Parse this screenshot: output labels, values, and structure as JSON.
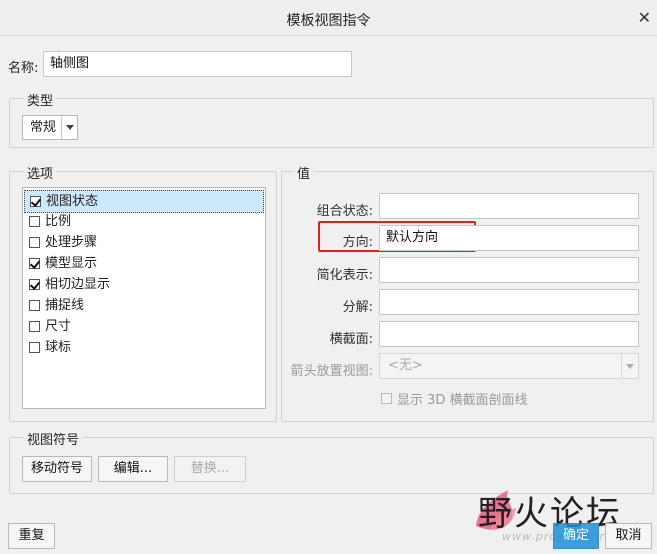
{
  "dialog": {
    "title": "模板视图指令",
    "close_icon": "close-icon"
  },
  "name_field": {
    "label": "名称:",
    "value": "轴侧图"
  },
  "type_group": {
    "label": "类型",
    "selected": "常规"
  },
  "options_group": {
    "label": "选项",
    "items": [
      {
        "label": "视图状态",
        "checked": true,
        "selected": true
      },
      {
        "label": "比例",
        "checked": false,
        "selected": false
      },
      {
        "label": "处理步骤",
        "checked": false,
        "selected": false
      },
      {
        "label": "模型显示",
        "checked": true,
        "selected": false
      },
      {
        "label": "相切边显示",
        "checked": true,
        "selected": false
      },
      {
        "label": "捕捉线",
        "checked": false,
        "selected": false
      },
      {
        "label": "尺寸",
        "checked": false,
        "selected": false
      },
      {
        "label": "球标",
        "checked": false,
        "selected": false
      }
    ]
  },
  "values_group": {
    "label": "值",
    "fields": {
      "combo_state": {
        "label": "组合状态:",
        "value": ""
      },
      "orientation": {
        "label": "方向:",
        "value": "默认方向"
      },
      "simplified_rep": {
        "label": "简化表示:",
        "value": ""
      },
      "explode": {
        "label": "分解:",
        "value": ""
      },
      "cross_section": {
        "label": "横截面:",
        "value": ""
      },
      "arrow_view": {
        "label": "箭头放置视图:",
        "value": "<无>"
      }
    },
    "show_hatch": {
      "label": "显示 3D 横截面剖面线",
      "checked": false
    }
  },
  "symbol_group": {
    "label": "视图符号",
    "move_label": "移动符号",
    "edit_label": "编辑...",
    "replace_label": "替换..."
  },
  "footer": {
    "reset_label": "重复",
    "ok_label": "确定",
    "cancel_label": "取消"
  },
  "watermark": {
    "text": "野火论坛",
    "url": "www.proewildfire.cn"
  },
  "colors": {
    "highlight": "#e0201e",
    "primary_button": "#1f8fd8",
    "selection": "#cde7fb"
  }
}
